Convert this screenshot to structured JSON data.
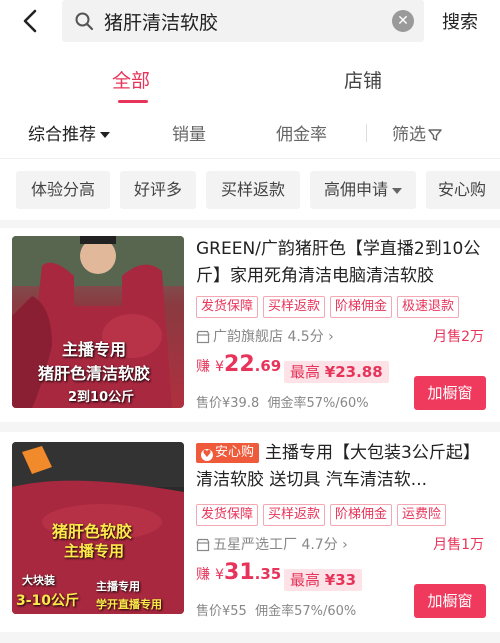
{
  "search": {
    "query": "猪肝清洁软胶",
    "button": "搜索"
  },
  "tabs": [
    {
      "label": "全部"
    },
    {
      "label": "店铺"
    }
  ],
  "sort": {
    "items": [
      "综合推荐",
      "销量",
      "佣金率",
      "筛选"
    ]
  },
  "chips": [
    "体验分高",
    "好评多",
    "买样返款",
    "高佣申请",
    "安心购"
  ],
  "products": [
    {
      "title": "GREEN/广韵猪肝色【学直播2到10公斤】家用死角清洁电脑清洁软胶",
      "tags": [
        "发货保障",
        "买样返款",
        "阶梯佣金",
        "极速退款"
      ],
      "shop": "广韵旗舰店 4.5分",
      "monthly": "月售2万",
      "earn_prefix": "赚",
      "earn_currency": "¥",
      "earn_int": "22",
      "earn_dec": ".69",
      "max_label": "最高",
      "max_value": "¥23.88",
      "price_label": "售价¥39.8",
      "rate_label": "佣金率57%/60%",
      "button": "加橱窗",
      "image_texts": [
        "主播专用",
        "猪肝色清洁软胶",
        "2到10公斤"
      ]
    },
    {
      "badge": "安心购",
      "title": "主播专用【大包装3公斤起】清洁软胶 送切具 汽车清洁软...",
      "tags": [
        "发货保障",
        "买样返款",
        "阶梯佣金",
        "运费险"
      ],
      "shop": "五星严选工厂 4.7分",
      "monthly": "月售1万",
      "earn_prefix": "赚",
      "earn_currency": "¥",
      "earn_int": "31",
      "earn_dec": ".35",
      "max_label": "最高",
      "max_value": "¥33",
      "price_label": "售价¥55",
      "rate_label": "佣金率57%/60%",
      "button": "加橱窗",
      "image_texts": [
        "猪肝色软胶",
        "主播专用",
        "大块装",
        "3-10公斤",
        "主播专用",
        "学开直播专用"
      ]
    }
  ],
  "colors": {
    "accent": "#e8345a",
    "button": "#ef3a5d",
    "tag_border": "#f4a8b4",
    "slime": "#a8283f"
  }
}
